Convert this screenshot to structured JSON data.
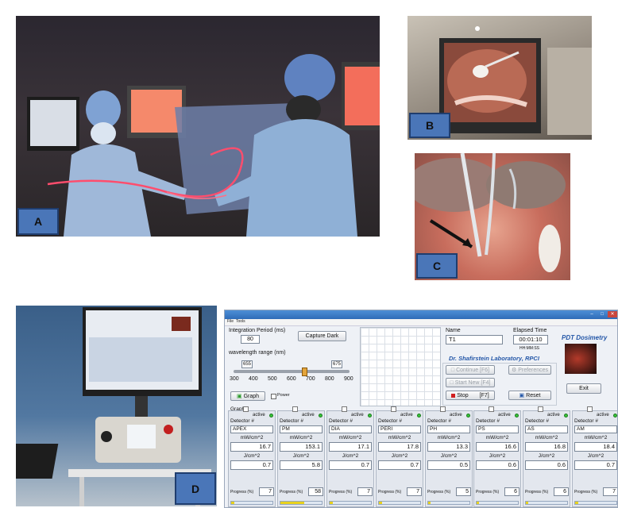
{
  "panel_labels": {
    "a": "A",
    "b": "B",
    "c": "C",
    "d": "D"
  },
  "app": {
    "title": "PDT Dosimetry",
    "lab": "Dr. Shafirstein Laboratory, RPCI",
    "menu": [
      "File",
      "Tools"
    ],
    "integration_label": "Integration Period (ms)",
    "integration_value": "80",
    "capture_dark": "Capture Dark",
    "wavelength_label": "wavelength range (nm)",
    "wl_min": "655",
    "wl_max": "675",
    "ticks": [
      "300",
      "400",
      "500",
      "600",
      "700",
      "800",
      "900"
    ],
    "graph_btn": "Graph",
    "power_chk": "Power",
    "graph_row_label": "Graph :",
    "name_label": "Name",
    "name_value": "T1",
    "elapsed_label": "Elapsed Time",
    "elapsed_value": "00:01:10",
    "elapsed_fmt": "HH:MM:SS",
    "continue_btn": "Continue  [F6]",
    "start_new_btn": "Start New  [F4]",
    "stop_btn": "Stop",
    "stop_key": "[F7]",
    "preferences_btn": "Preferences",
    "reset_btn": "Reset",
    "exit_btn": "Exit",
    "active_label": "active",
    "detector_label": "Detector #",
    "power_unit": "mW/cm^2",
    "dose_unit": "J/cm^2",
    "progress_label": "Progress (%)"
  },
  "detectors": [
    {
      "name": "APEX",
      "power": "16.7",
      "dose": "0.7",
      "progress": "7",
      "fill": 0.07
    },
    {
      "name": "PM",
      "power": "153.1",
      "dose": "5.8",
      "progress": "58",
      "fill": 0.58
    },
    {
      "name": "DIA",
      "power": "17.1",
      "dose": "0.7",
      "progress": "7",
      "fill": 0.07
    },
    {
      "name": "PERI",
      "power": "17.8",
      "dose": "0.7",
      "progress": "7",
      "fill": 0.07
    },
    {
      "name": "PH",
      "power": "13.3",
      "dose": "0.5",
      "progress": "5",
      "fill": 0.05
    },
    {
      "name": "PS",
      "power": "16.6",
      "dose": "0.6",
      "progress": "6",
      "fill": 0.06
    },
    {
      "name": "AS",
      "power": "16.8",
      "dose": "0.6",
      "progress": "6",
      "fill": 0.06
    },
    {
      "name": "AM",
      "power": "18.4",
      "dose": "0.7",
      "progress": "7",
      "fill": 0.07
    }
  ],
  "colors": {
    "label_bg": "#4a76b8",
    "title_blue": "#2457a8",
    "laser": "#ff4d6d"
  }
}
